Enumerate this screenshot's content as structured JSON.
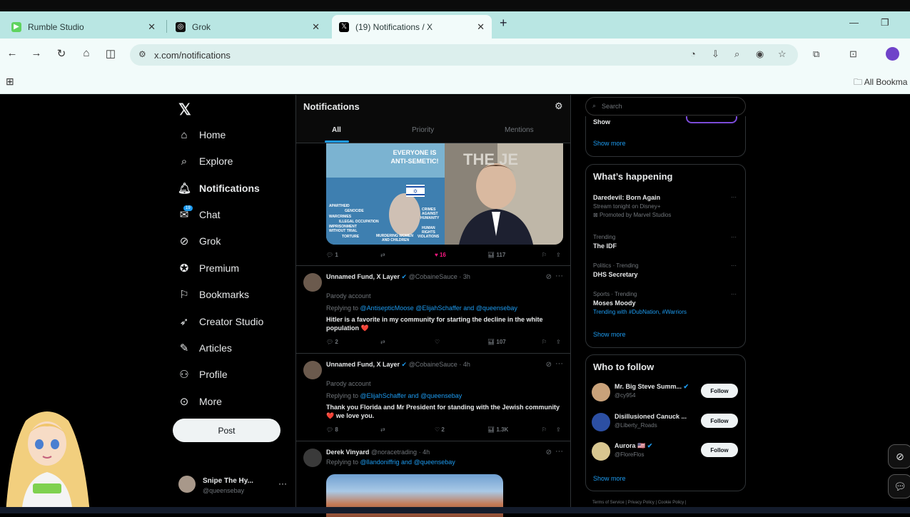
{
  "browser": {
    "tabs": [
      {
        "title": "Rumble Studio",
        "favicon": "rumble-icon",
        "color": "#5fd35f"
      },
      {
        "title": "Grok",
        "favicon": "grok-icon",
        "color": "#111111"
      },
      {
        "title": "(19) Notifications / X",
        "favicon": "x-icon",
        "color": "#000000"
      }
    ],
    "url": "x.com/notifications",
    "bookmarks_label": "All Bookma"
  },
  "sidebar": {
    "logo": "𝕏",
    "items": [
      {
        "label": "Home",
        "icon": "home-icon"
      },
      {
        "label": "Explore",
        "icon": "search-icon"
      },
      {
        "label": "Notifications",
        "icon": "bell-icon"
      },
      {
        "label": "Chat",
        "icon": "chat-icon",
        "badge": "19"
      },
      {
        "label": "Grok",
        "icon": "grok-icon"
      },
      {
        "label": "Premium",
        "icon": "premium-icon"
      },
      {
        "label": "Bookmarks",
        "icon": "bookmark-icon"
      },
      {
        "label": "Creator Studio",
        "icon": "rocket-icon"
      },
      {
        "label": "Articles",
        "icon": "article-icon"
      },
      {
        "label": "Profile",
        "icon": "person-icon"
      },
      {
        "label": "More",
        "icon": "more-icon"
      }
    ],
    "post_label": "Post",
    "account": {
      "name": "Snipe The Hy...",
      "handle": "@queensebay"
    }
  },
  "feed": {
    "title": "Notifications",
    "tabs": [
      "All",
      "Priority",
      "Mentions"
    ],
    "image_post": {
      "meme_top": "EVERYONE IS ANTI-SEMETIC!",
      "meme_left": [
        "APARTHEID",
        "GENOCIDE",
        "WARCRIMES",
        "ILLEGAL OCCUPATION",
        "IMPRISONMENT WITHOUT TRIAL",
        "TORTURE"
      ],
      "meme_right": [
        "CRIMES AGAINST HUMANITY",
        "HUMAN RIGHTS VIOLATIONS"
      ],
      "meme_bottom": "MURDERING WOMEN AND CHILDREN",
      "meme_photo_text": "THE JE",
      "replies": "1",
      "likes": "16",
      "views": "117"
    },
    "posts": [
      {
        "name": "Unnamed Fund, X Layer",
        "handle": "@CobaineSauce",
        "time": "3h",
        "note": "Parody account",
        "replying_label": "Replying to",
        "replying_to": "@AntisepticMoose @ElijahSchaffer and @queensebay",
        "text": "Hitler is a favorite in my community for starting the decline in the white population ❤️",
        "replies": "2",
        "likes": "",
        "views": "107"
      },
      {
        "name": "Unnamed Fund, X Layer",
        "handle": "@CobaineSauce",
        "time": "4h",
        "note": "Parody account",
        "replying_label": "Replying to",
        "replying_to": "@ElijahSchaffer and @queensebay",
        "text": "Thank you Florida and Mr President for standing with the Jewish community ❤️ we love you.",
        "replies": "8",
        "likes": "2",
        "views": "1.3K"
      },
      {
        "name": "Derek Vinyard",
        "handle": "@noracetrading",
        "time": "4h",
        "replying_label": "Replying to",
        "replying_to": "@llandoniffrig and @queensebay"
      }
    ]
  },
  "right": {
    "search_placeholder": "Search",
    "top_card": {
      "partial_title": "Show",
      "show_more": "Show more"
    },
    "happening": {
      "title": "What’s happening",
      "trends": [
        {
          "context": "",
          "title": "Daredevil: Born Again",
          "sub": "Stream tonight on Disney+",
          "extra": "Promoted by Marvel Studios"
        },
        {
          "context": "Trending",
          "title": "The IDF",
          "sub": "",
          "extra": ""
        },
        {
          "context": "Politics · Trending",
          "title": "DHS Secretary",
          "sub": "",
          "extra": ""
        },
        {
          "context": "Sports · Trending",
          "title": "Moses Moody",
          "sub": "Trending with #DubNation, #Warriors",
          "extra": ""
        }
      ],
      "show_more": "Show more"
    },
    "who_to_follow": {
      "title": "Who to follow",
      "accounts": [
        {
          "name": "Mr. Big Steve Summ...",
          "handle": "@cy954",
          "follow": "Follow"
        },
        {
          "name": "Disillusioned Canuck ...",
          "handle": "@Liberty_Roads",
          "follow": "Follow"
        },
        {
          "name": "Aurora 🇺🇸",
          "handle": "@FloreFlos",
          "follow": "Follow"
        }
      ],
      "show_more": "Show more"
    },
    "footer": [
      "Terms of Service",
      "Privacy Policy",
      "Cookie Policy"
    ]
  },
  "colors": {
    "accent": "#1d9bf0",
    "like": "#f91880",
    "background": "#000000"
  }
}
